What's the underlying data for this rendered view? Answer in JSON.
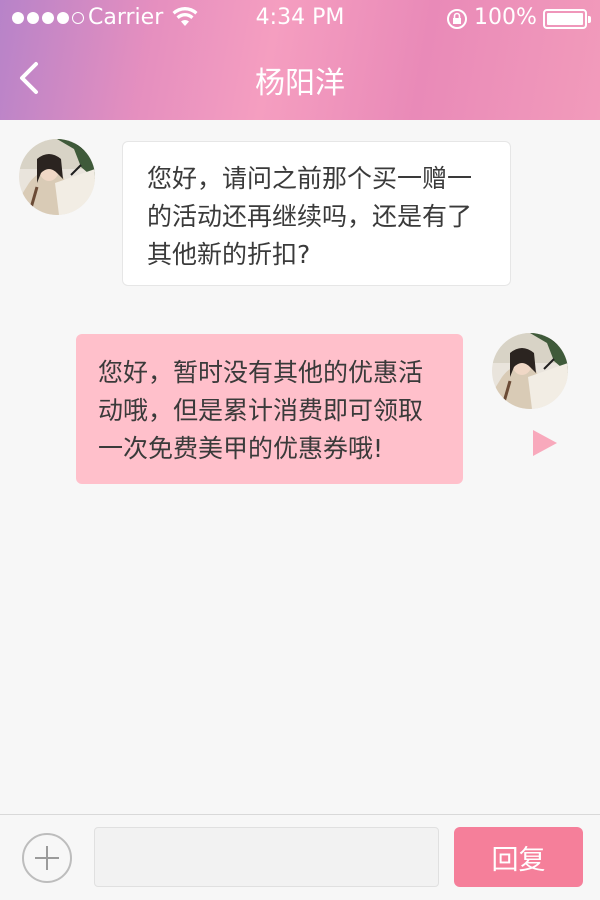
{
  "status_bar": {
    "carrier": "Carrier",
    "time": "4:34 PM",
    "battery_percent": "100%",
    "signal_bars": 4,
    "signal_max": 5
  },
  "nav": {
    "back_icon": "chevron-left-icon",
    "title": "杨阳洋"
  },
  "messages": [
    {
      "direction": "incoming",
      "text": "您好，请问之前那个买一赠一的活动还再继续吗，还是有了其他新的折扣?"
    },
    {
      "direction": "outgoing",
      "text": "您好，暂时没有其他的优惠活动哦，但是累计消费即可领取一次免费美甲的优惠券哦!"
    }
  ],
  "input_bar": {
    "add_icon": "plus-icon",
    "input_value": "",
    "input_placeholder": "",
    "reply_label": "回复"
  },
  "colors": {
    "header_gradient": [
      "#b783c9",
      "#f59ec0",
      "#f29bbb"
    ],
    "outgoing_bubble": "#ffc0cb",
    "incoming_bubble": "#ffffff",
    "reply_button": "#f57f9a",
    "play_icon": "#f8a9bc"
  }
}
